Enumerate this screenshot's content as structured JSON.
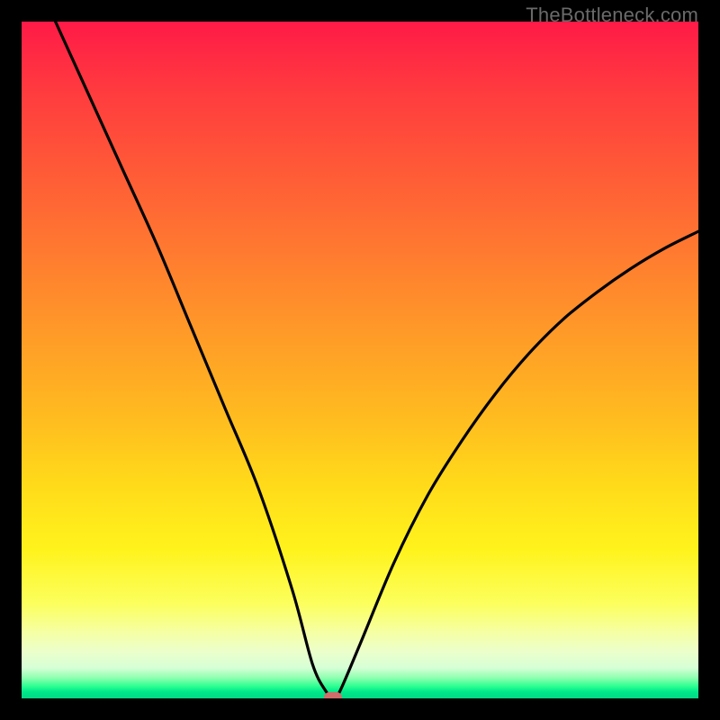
{
  "watermark": "TheBottleneck.com",
  "colors": {
    "frame": "#000000",
    "curve": "#000000",
    "marker": "#cf6d6a",
    "gradient_top": "#ff1a47",
    "gradient_mid": "#ffd91a",
    "gradient_bottom": "#00d884"
  },
  "chart_data": {
    "type": "line",
    "title": "",
    "xlabel": "",
    "ylabel": "",
    "xlim": [
      0,
      100
    ],
    "ylim": [
      0,
      100
    ],
    "grid": false,
    "legend": false,
    "series": [
      {
        "name": "bottleneck-curve",
        "x": [
          5,
          10,
          15,
          20,
          25,
          30,
          35,
          40,
          43,
          45,
          46,
          47,
          50,
          55,
          60,
          65,
          70,
          75,
          80,
          85,
          90,
          95,
          100
        ],
        "y": [
          100,
          89,
          78,
          67,
          55,
          43,
          31,
          16,
          5,
          1,
          0,
          1,
          8,
          20,
          30,
          38,
          45,
          51,
          56,
          60,
          63.5,
          66.5,
          69
        ]
      }
    ],
    "annotations": [
      {
        "name": "min-marker",
        "x": 46,
        "y": 0
      }
    ]
  }
}
